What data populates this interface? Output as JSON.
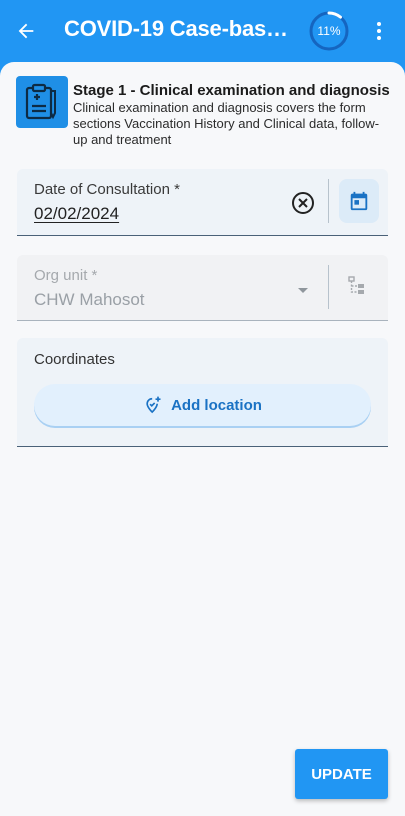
{
  "appbar": {
    "title": "COVID-19 Case-based ...",
    "progress_label": "11%",
    "progress_fraction": 0.11,
    "back_icon": "arrow-left-icon",
    "more_icon": "more-vertical-icon"
  },
  "stage": {
    "icon": "clipboard-medical-icon",
    "title": "Stage 1 - Clinical examination and diagnosis",
    "description": "Clinical examination and diagnosis covers the form sections Vaccination History and Clinical data, follow-up and treatment"
  },
  "form": {
    "date": {
      "label": "Date of Consultation *",
      "value": "02/02/2024",
      "clear_icon": "clear-circle-icon",
      "calendar_icon": "calendar-icon"
    },
    "org_unit": {
      "label": "Org unit *",
      "value": "CHW Mahosot",
      "dropdown_icon": "chevron-down-icon",
      "tree_icon": "org-tree-icon"
    },
    "coordinates": {
      "label": "Coordinates",
      "button_label": "Add location",
      "button_icon": "add-location-icon"
    }
  },
  "actions": {
    "update_label": "UPDATE"
  },
  "colors": {
    "primary": "#2196f3",
    "field_bg": "#eef3f8",
    "link_blue": "#1a72c4"
  }
}
